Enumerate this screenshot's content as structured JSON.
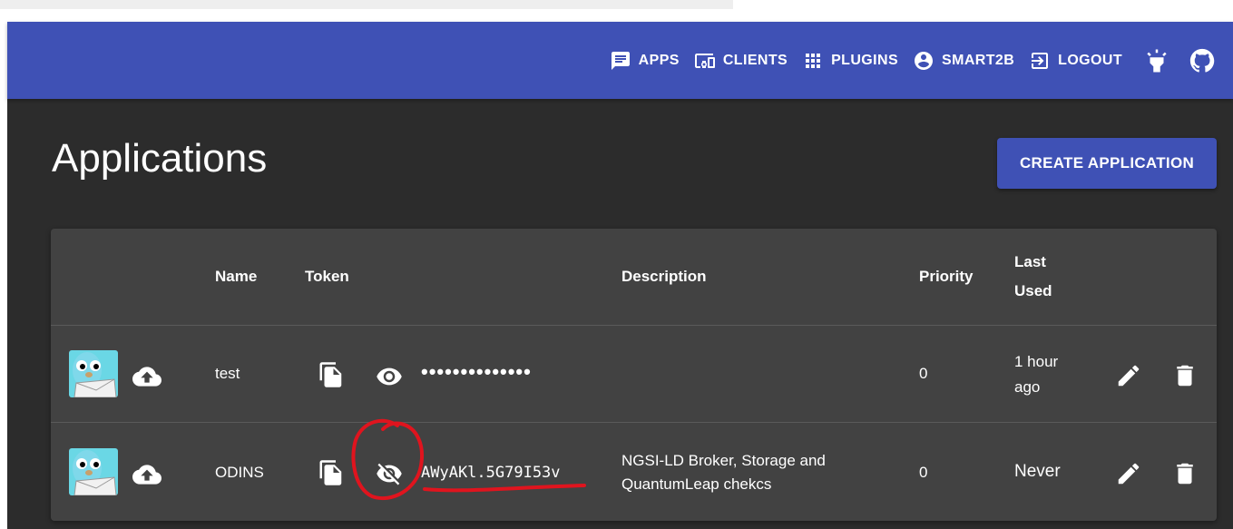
{
  "nav": {
    "apps": "APPS",
    "clients": "CLIENTS",
    "plugins": "PLUGINS",
    "user": "SMART2B",
    "logout": "LOGOUT"
  },
  "page": {
    "title": "Applications",
    "create_button": "CREATE APPLICATION"
  },
  "table": {
    "headers": {
      "name": "Name",
      "token": "Token",
      "description": "Description",
      "priority": "Priority",
      "last_used_1": "Last",
      "last_used_2": "Used"
    },
    "rows": [
      {
        "name": "test",
        "token": "••••••••••••••",
        "description": "",
        "priority": "0",
        "last_used_1": "1 hour",
        "last_used_2": "ago"
      },
      {
        "name": "ODINS",
        "token": "AWyAKl.5G79I53v",
        "description_1": "NGSI-LD Broker, Storage and",
        "description_2": "QuantumLeap chekcs",
        "priority": "0",
        "last_used": "Never"
      }
    ]
  },
  "icons": [
    "message-icon",
    "devices-icon",
    "apps-grid-icon",
    "account-circle-icon",
    "logout-icon",
    "lightbulb-icon",
    "github-icon",
    "cloud-upload-icon",
    "copy-icon",
    "eye-icon",
    "eye-off-icon",
    "pencil-icon",
    "trash-icon"
  ],
  "colors": {
    "appbar": "#3f51b5",
    "background": "#2c2c2c",
    "card": "#424242",
    "annotation": "#e0141e"
  }
}
